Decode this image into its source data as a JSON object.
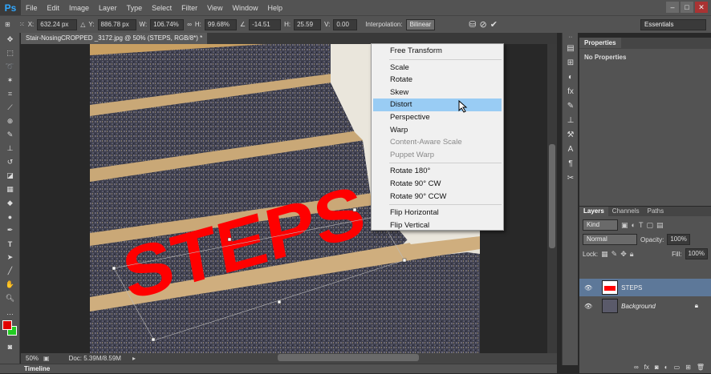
{
  "app": {
    "logo": "Ps"
  },
  "menu": [
    "File",
    "Edit",
    "Image",
    "Layer",
    "Type",
    "Select",
    "Filter",
    "View",
    "Window",
    "Help"
  ],
  "window_controls": {
    "minimize": "–",
    "maximize": "□",
    "close": "✕"
  },
  "options": {
    "x_label": "X:",
    "x": "632.24 px",
    "y_label": "Y:",
    "y": "886.78 px",
    "w_label": "W:",
    "w": "106.74%",
    "h_label": "H:",
    "h": "99.68%",
    "angle": "-14.51",
    "hskew_label": "H:",
    "hskew": "25.59",
    "vskew_label": "V:",
    "vskew": "0.00",
    "interp_label": "Interpolation:",
    "interp": "Bilinear",
    "workspace": "Essentials"
  },
  "document": {
    "tab_title": "Stair-NosingCROPPED _3172.jpg @ 50% (STEPS, RGB/8*) *",
    "zoom": "50%",
    "doc_info": "Doc: 5.39M/8.59M",
    "text_layer": "STEPS"
  },
  "context_menu": {
    "items": [
      {
        "label": "Free Transform",
        "state": "normal"
      },
      {
        "sep": true
      },
      {
        "label": "Scale",
        "state": "normal"
      },
      {
        "label": "Rotate",
        "state": "normal"
      },
      {
        "label": "Skew",
        "state": "normal"
      },
      {
        "label": "Distort",
        "state": "highlighted"
      },
      {
        "label": "Perspective",
        "state": "normal"
      },
      {
        "label": "Warp",
        "state": "normal"
      },
      {
        "label": "Content-Aware Scale",
        "state": "disabled"
      },
      {
        "label": "Puppet Warp",
        "state": "disabled"
      },
      {
        "sep": true
      },
      {
        "label": "Rotate 180°",
        "state": "normal"
      },
      {
        "label": "Rotate 90° CW",
        "state": "normal"
      },
      {
        "label": "Rotate 90° CCW",
        "state": "normal"
      },
      {
        "sep": true
      },
      {
        "label": "Flip Horizontal",
        "state": "normal"
      },
      {
        "label": "Flip Vertical",
        "state": "normal"
      }
    ]
  },
  "properties": {
    "tab": "Properties",
    "content": "No Properties"
  },
  "layers": {
    "tabs": [
      "Layers",
      "Channels",
      "Paths"
    ],
    "filter_kind": "Kind",
    "blend_mode": "Normal",
    "opacity_label": "Opacity:",
    "opacity": "100%",
    "lock_label": "Lock:",
    "fill_label": "Fill:",
    "fill": "100%",
    "items": [
      {
        "name": "STEPS",
        "selected": true
      },
      {
        "name": "Background",
        "selected": false
      }
    ]
  },
  "timeline": {
    "label": "Timeline"
  },
  "colors": {
    "foreground": "#e00000",
    "background": "#22cc22",
    "text_fill": "#ff0000",
    "menu_highlight": "#99ccf4"
  }
}
